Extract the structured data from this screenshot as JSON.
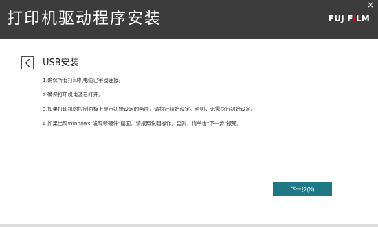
{
  "window": {
    "title": "打印机驱动程序安装",
    "close_label": "×"
  },
  "brand": {
    "logo_prefix": "FUJ",
    "logo_mark": "i",
    "logo_mid": "F",
    "logo_mark2": "i",
    "logo_suffix": "LM",
    "primary_color": "#3c3c3c",
    "accent_color": "#1e7886",
    "logo_accent_color": "#e60012"
  },
  "section": {
    "title": "USB安装",
    "back_icon": "chevron-left-icon"
  },
  "steps": [
    "1.确保所有打印机电缆已牢固连接。",
    "2.确保打印机电源已打开。",
    "3.如果打印机的控制面板上显示初始设定的画面，请执行初始设定。否则，无需执行初始设定。",
    "4.如果出现Windows\"发现新硬件\"画面，请按照说明操作。否则，请单击\"下一步\"按钮。"
  ],
  "footer": {
    "next_label": "下一步(N)"
  }
}
